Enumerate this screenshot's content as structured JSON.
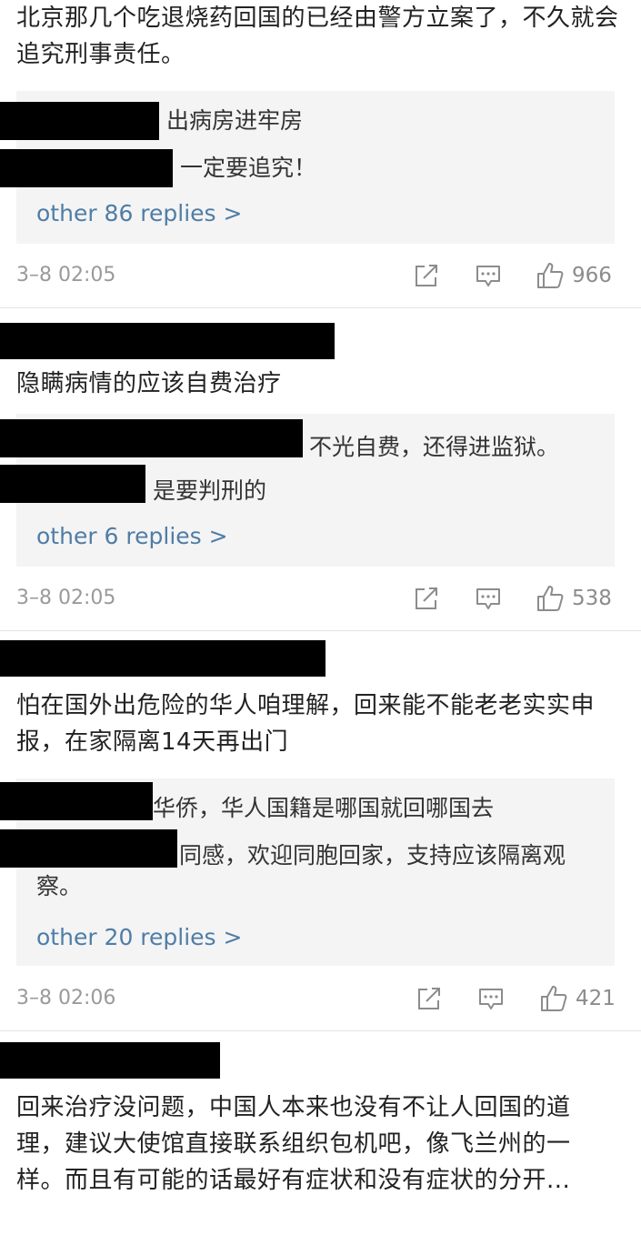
{
  "comments": [
    {
      "text": "北京那几个吃退烧药回国的已经由警方立案了，不久就会追究刑事责任。",
      "replies": [
        "出病房进牢房",
        "一定要追究！"
      ],
      "other_replies": "other 86 replies >",
      "time": "3–8 02:05",
      "likes": "966"
    },
    {
      "text": "隐瞒病情的应该自费治疗",
      "replies": [
        "不光自费，还得进监狱。",
        "是要判刑的"
      ],
      "other_replies": "other 6 replies >",
      "time": "3–8 02:05",
      "likes": "538"
    },
    {
      "text": "怕在国外出危险的华人咱理解，回来能不能老老实实申报，在家隔离14天再出门",
      "replies": [
        "华侨，华人国籍是哪国就回哪国去",
        "同感，欢迎同胞回家，支持应该隔离观察。"
      ],
      "other_replies": "other 20 replies >",
      "time": "3–8 02:06",
      "likes": "421"
    },
    {
      "text": "回来治疗没问题，中国人本来也没有不让人回国的道理，建议大使馆直接联系组织包机吧，像飞兰州的一样。而且有可能的话最好有症状和没有症状的分开..."
    }
  ],
  "icons": {
    "share": "share-icon",
    "comment": "comment-icon",
    "like": "thumbs-up-icon"
  },
  "colors": {
    "link": "#4f7da6",
    "reply_bg": "#f4f4f4",
    "meta": "#9a9a9a",
    "redaction": "#000000"
  }
}
